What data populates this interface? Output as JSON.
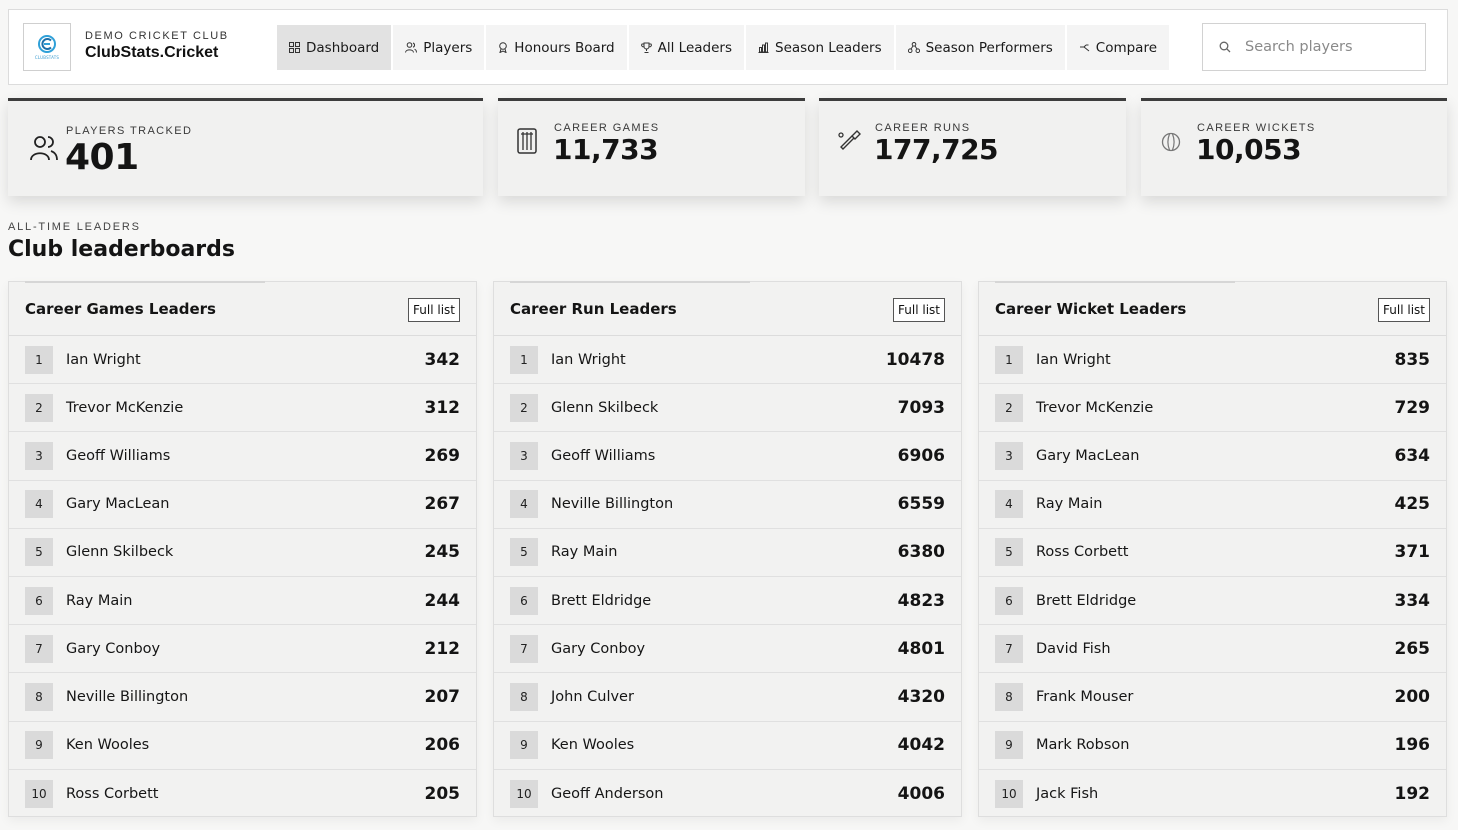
{
  "header": {
    "club_subtitle": "DEMO CRICKET CLUB",
    "club_name": "ClubStats.Cricket",
    "logo_text": "CLUBSTATS",
    "nav": [
      {
        "label": "Dashboard",
        "icon": "grid-icon",
        "active": true
      },
      {
        "label": "Players",
        "icon": "users-icon",
        "active": false
      },
      {
        "label": "Honours Board",
        "icon": "award-icon",
        "active": false
      },
      {
        "label": "All Leaders",
        "icon": "trophy-icon",
        "active": false
      },
      {
        "label": "Season Leaders",
        "icon": "bar-chart-icon",
        "active": false
      },
      {
        "label": "Season Performers",
        "icon": "network-icon",
        "active": false
      },
      {
        "label": "Compare",
        "icon": "compare-icon",
        "active": false
      }
    ],
    "search": {
      "placeholder": "Search players",
      "value": ""
    }
  },
  "stats": [
    {
      "label": "PLAYERS TRACKED",
      "value": "401",
      "icon": "users-icon"
    },
    {
      "label": "CAREER GAMES",
      "value": "11,733",
      "icon": "wickets-icon"
    },
    {
      "label": "CAREER RUNS",
      "value": "177,725",
      "icon": "bat-icon"
    },
    {
      "label": "CAREER WICKETS",
      "value": "10,053",
      "icon": "ball-icon"
    }
  ],
  "section": {
    "eyebrow": "ALL-TIME LEADERS",
    "title": "Club leaderboards"
  },
  "boards": [
    {
      "title": "Career Games Leaders",
      "button": "Full list",
      "rows": [
        {
          "rank": "1",
          "name": "Ian Wright",
          "value": "342"
        },
        {
          "rank": "2",
          "name": "Trevor McKenzie",
          "value": "312"
        },
        {
          "rank": "3",
          "name": "Geoff Williams",
          "value": "269"
        },
        {
          "rank": "4",
          "name": "Gary MacLean",
          "value": "267"
        },
        {
          "rank": "5",
          "name": "Glenn Skilbeck",
          "value": "245"
        },
        {
          "rank": "6",
          "name": "Ray Main",
          "value": "244"
        },
        {
          "rank": "7",
          "name": "Gary Conboy",
          "value": "212"
        },
        {
          "rank": "8",
          "name": "Neville Billington",
          "value": "207"
        },
        {
          "rank": "9",
          "name": "Ken Wooles",
          "value": "206"
        },
        {
          "rank": "10",
          "name": "Ross Corbett",
          "value": "205"
        }
      ]
    },
    {
      "title": "Career Run Leaders",
      "button": "Full list",
      "rows": [
        {
          "rank": "1",
          "name": "Ian Wright",
          "value": "10478"
        },
        {
          "rank": "2",
          "name": "Glenn Skilbeck",
          "value": "7093"
        },
        {
          "rank": "3",
          "name": "Geoff Williams",
          "value": "6906"
        },
        {
          "rank": "4",
          "name": "Neville Billington",
          "value": "6559"
        },
        {
          "rank": "5",
          "name": "Ray Main",
          "value": "6380"
        },
        {
          "rank": "6",
          "name": "Brett Eldridge",
          "value": "4823"
        },
        {
          "rank": "7",
          "name": "Gary Conboy",
          "value": "4801"
        },
        {
          "rank": "8",
          "name": "John Culver",
          "value": "4320"
        },
        {
          "rank": "9",
          "name": "Ken Wooles",
          "value": "4042"
        },
        {
          "rank": "10",
          "name": "Geoff Anderson",
          "value": "4006"
        }
      ]
    },
    {
      "title": "Career Wicket Leaders",
      "button": "Full list",
      "rows": [
        {
          "rank": "1",
          "name": "Ian Wright",
          "value": "835"
        },
        {
          "rank": "2",
          "name": "Trevor McKenzie",
          "value": "729"
        },
        {
          "rank": "3",
          "name": "Gary MacLean",
          "value": "634"
        },
        {
          "rank": "4",
          "name": "Ray Main",
          "value": "425"
        },
        {
          "rank": "5",
          "name": "Ross Corbett",
          "value": "371"
        },
        {
          "rank": "6",
          "name": "Brett Eldridge",
          "value": "334"
        },
        {
          "rank": "7",
          "name": "David Fish",
          "value": "265"
        },
        {
          "rank": "8",
          "name": "Frank Mouser",
          "value": "200"
        },
        {
          "rank": "9",
          "name": "Mark Robson",
          "value": "196"
        },
        {
          "rank": "10",
          "name": "Jack Fish",
          "value": "192"
        }
      ]
    }
  ]
}
